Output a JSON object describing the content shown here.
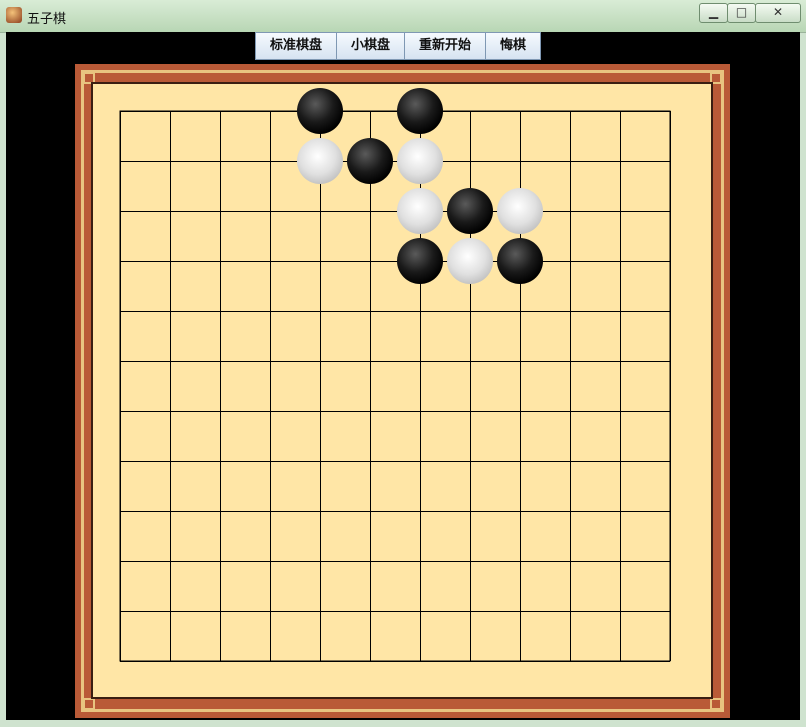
{
  "window": {
    "title": "五子棋",
    "icon": "gomoku-app-icon",
    "controls": {
      "minimize": "▁",
      "maximize": "□",
      "close": "✕"
    }
  },
  "toolbar": {
    "buttons": [
      {
        "label": "标准棋盘",
        "name": "standard-board-button"
      },
      {
        "label": "小棋盘",
        "name": "small-board-button"
      },
      {
        "label": "重新开始",
        "name": "restart-button"
      },
      {
        "label": "悔棋",
        "name": "undo-button"
      }
    ]
  },
  "board": {
    "rows": 12,
    "cols": 12,
    "colors": {
      "background": "#ffe6a6",
      "line": "#000000",
      "black_stone": "#1a1a1a",
      "white_stone": "#e0e0e0",
      "frame": "#b95a37"
    },
    "stones": [
      {
        "color": "black",
        "col": 4,
        "row": 0
      },
      {
        "color": "black",
        "col": 6,
        "row": 0
      },
      {
        "color": "white",
        "col": 4,
        "row": 1
      },
      {
        "color": "black",
        "col": 5,
        "row": 1
      },
      {
        "color": "white",
        "col": 6,
        "row": 1
      },
      {
        "color": "white",
        "col": 6,
        "row": 2
      },
      {
        "color": "black",
        "col": 7,
        "row": 2
      },
      {
        "color": "white",
        "col": 8,
        "row": 2
      },
      {
        "color": "black",
        "col": 6,
        "row": 3
      },
      {
        "color": "white",
        "col": 7,
        "row": 3
      },
      {
        "color": "black",
        "col": 8,
        "row": 3
      }
    ]
  }
}
